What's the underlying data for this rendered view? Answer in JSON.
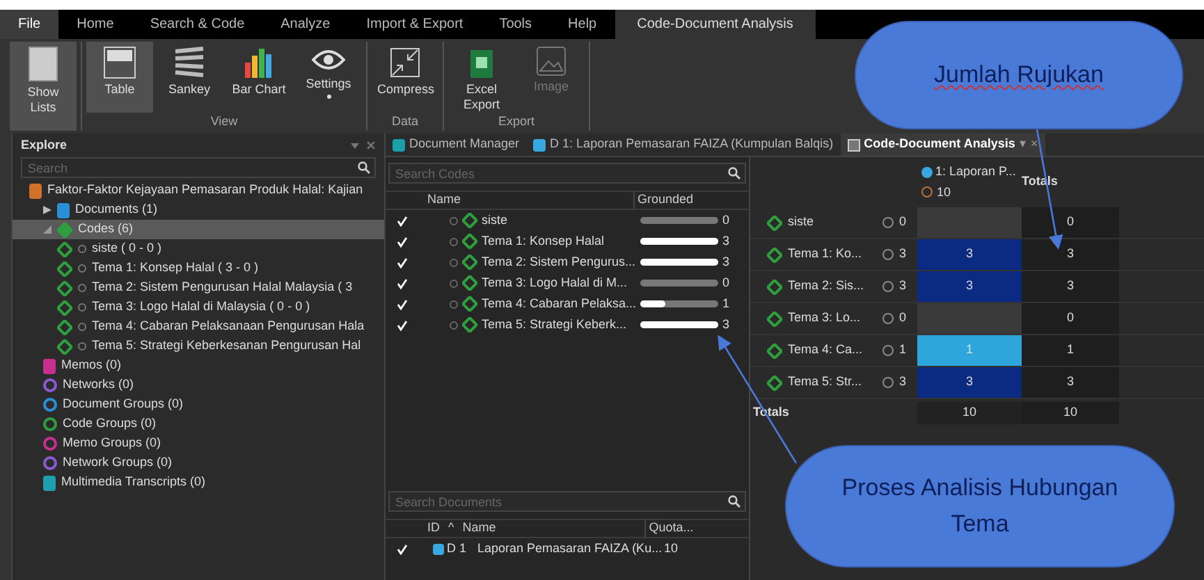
{
  "menu_tabs": [
    {
      "label": "File",
      "selected": false,
      "kind": "file"
    },
    {
      "label": "Home",
      "selected": false,
      "kind": "tab"
    },
    {
      "label": "Search & Code",
      "selected": false,
      "kind": "tab"
    },
    {
      "label": "Analyze",
      "selected": false,
      "kind": "tab"
    },
    {
      "label": "Import & Export",
      "selected": false,
      "kind": "tab"
    },
    {
      "label": "Tools",
      "selected": false,
      "kind": "tab"
    },
    {
      "label": "Help",
      "selected": false,
      "kind": "tab"
    },
    {
      "label": "Code-Document Analysis",
      "selected": true,
      "kind": "tab"
    }
  ],
  "ribbon": [
    {
      "buttons": [
        {
          "label": "Show Lists",
          "kind": "lists",
          "selected": true,
          "disabled": false
        }
      ]
    },
    {
      "group": "View",
      "buttons": [
        {
          "label": "Table",
          "kind": "table",
          "selected": true,
          "disabled": false
        },
        {
          "label": "Sankey",
          "kind": "sankey",
          "selected": false,
          "disabled": false
        },
        {
          "label": "Bar Chart",
          "kind": "bars",
          "selected": false,
          "disabled": false
        },
        {
          "label": "Settings",
          "kind": "eye",
          "selected": false,
          "disabled": false,
          "dropdown": true
        }
      ]
    },
    {
      "group": "Data",
      "buttons": [
        {
          "label": "Compress",
          "kind": "compress",
          "selected": false,
          "disabled": false
        }
      ]
    },
    {
      "group": "Export",
      "buttons": [
        {
          "label": "Excel Export",
          "kind": "excel",
          "selected": false,
          "disabled": false
        },
        {
          "label": "Image",
          "kind": "image",
          "selected": false,
          "disabled": true
        }
      ]
    }
  ],
  "explore": {
    "title": "Explore",
    "search": {
      "placeholder": "Search"
    },
    "tree": [
      {
        "label": "Faktor-Faktor Kejayaan Pemasaran Produk Halal: Kajian",
        "kind": "project",
        "selected": false,
        "children": [
          {
            "label": "Documents (1)",
            "kind": "documents",
            "expanded": false,
            "selected": false
          },
          {
            "label": "Codes (6)",
            "kind": "codes",
            "expanded": true,
            "selected": true,
            "children": [
              {
                "label": "siste ( 0 - 0 )",
                "kind": "code",
                "selected": false
              },
              {
                "label": "Tema 1: Konsep Halal ( 3 - 0 )",
                "kind": "code",
                "selected": false
              },
              {
                "label": "Tema 2: Sistem Pengurusan Halal Malaysia ( 3",
                "kind": "code",
                "selected": false
              },
              {
                "label": "Tema 3: Logo Halal di Malaysia ( 0 - 0 )",
                "kind": "code",
                "selected": false
              },
              {
                "label": "Tema 4: Cabaran Pelaksanaan Pengurusan Hala",
                "kind": "code",
                "selected": false
              },
              {
                "label": "Tema 5: Strategi Keberkesanan Pengurusan Hal",
                "kind": "code",
                "selected": false
              }
            ]
          },
          {
            "label": "Memos (0)",
            "kind": "memos",
            "selected": false
          },
          {
            "label": "Networks (0)",
            "kind": "networks",
            "selected": false
          },
          {
            "label": "Document Groups (0)",
            "kind": "document-groups",
            "selected": false
          },
          {
            "label": "Code Groups (0)",
            "kind": "code-groups",
            "selected": false
          },
          {
            "label": "Memo Groups (0)",
            "kind": "memo-groups",
            "selected": false
          },
          {
            "label": "Network Groups (0)",
            "kind": "network-groups",
            "selected": false
          },
          {
            "label": "Multimedia Transcripts (0)",
            "kind": "transcripts",
            "selected": false
          }
        ]
      }
    ]
  },
  "doc_tabs": [
    {
      "label": "Document Manager",
      "kind": "manager",
      "selected": false
    },
    {
      "label": "D 1: Laporan Pemasaran FAIZA (Kumpulan Balqis)",
      "kind": "document",
      "selected": false
    },
    {
      "label": "Code-Document Analysis",
      "kind": "analysis",
      "selected": true,
      "menu": "▾",
      "close": "×"
    }
  ],
  "codes_list": {
    "search": {
      "placeholder": "Search Codes"
    },
    "columns": [
      "Name",
      "Grounded"
    ],
    "rows": [
      {
        "name": "siste",
        "checked": true,
        "level": 0,
        "grounded": "0"
      },
      {
        "name": "Tema 1: Konsep Halal",
        "checked": true,
        "level": 1,
        "grounded": "3"
      },
      {
        "name": "Tema 2: Sistem Pengurus...",
        "checked": true,
        "level": 1,
        "grounded": "3"
      },
      {
        "name": "Tema 3: Logo Halal di M...",
        "checked": true,
        "level": 0,
        "grounded": "0"
      },
      {
        "name": "Tema 4: Cabaran Pelaksa...",
        "checked": true,
        "level": 0.33,
        "grounded": "1"
      },
      {
        "name": "Tema 5: Strategi Keberk...",
        "checked": true,
        "level": 1,
        "grounded": "3"
      }
    ]
  },
  "documents_list": {
    "search": {
      "placeholder": "Search Documents"
    },
    "columns": [
      "ID",
      "^",
      "Name",
      "Quota..."
    ],
    "rows": [
      {
        "checked": true,
        "id": "D 1",
        "name": "Laporan Pemasaran FAIZA (Ku...",
        "quotations": "10"
      }
    ]
  },
  "matrix": {
    "column": {
      "label": "1: Laporan P...",
      "count": "10"
    },
    "totals_header": "Totals",
    "rows": [
      {
        "code": "siste",
        "count": "0",
        "cell": null,
        "total": "0"
      },
      {
        "code": "Tema 1: Ko...",
        "count": "3",
        "cell": {
          "value": "3",
          "color": "#0b2a82"
        },
        "total": "3"
      },
      {
        "code": "Tema 2: Sis...",
        "count": "3",
        "cell": {
          "value": "3",
          "color": "#0b2a82"
        },
        "total": "3"
      },
      {
        "code": "Tema 3: Lo...",
        "count": "0",
        "cell": null,
        "total": "0"
      },
      {
        "code": "Tema 4: Ca...",
        "count": "1",
        "cell": {
          "value": "1",
          "color": "#2ea6dc"
        },
        "total": "1"
      },
      {
        "code": "Tema 5: Str...",
        "count": "3",
        "cell": {
          "value": "3",
          "color": "#0b2a82"
        },
        "total": "3"
      }
    ],
    "totals": {
      "label": "Totals",
      "column": "10",
      "total": "10"
    }
  },
  "callouts": [
    {
      "text": "Jumlah Rujukan"
    },
    {
      "text": "Proses Analisis Hubungan Tema"
    }
  ]
}
